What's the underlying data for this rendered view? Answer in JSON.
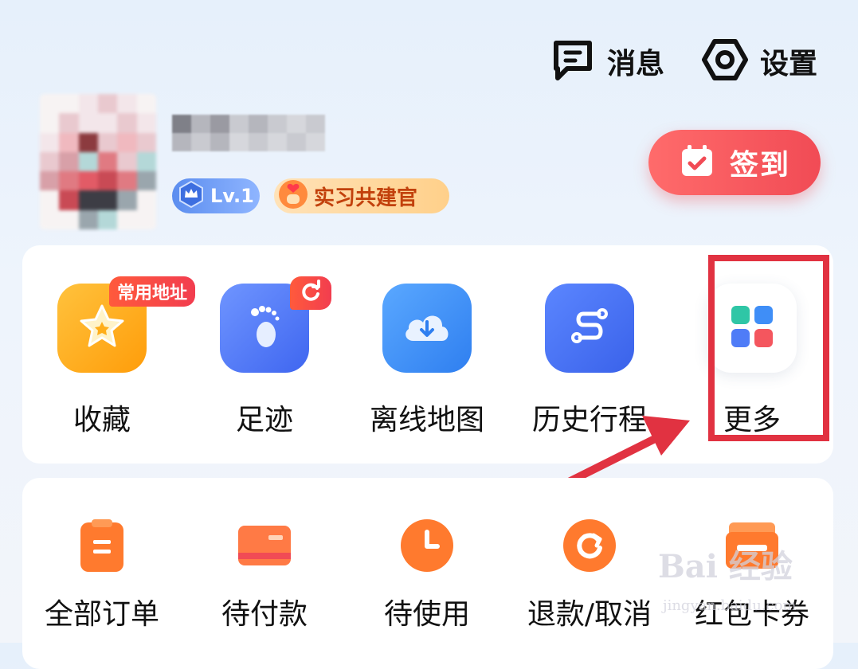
{
  "header": {
    "messages_label": "消息",
    "settings_label": "设置"
  },
  "profile": {
    "level_badge": "Lv.1",
    "title_badge": "实习共建官",
    "checkin_label": "签到"
  },
  "tools": [
    {
      "label": "收藏",
      "icon": "star-icon",
      "color": "#ffb31a",
      "tag": "常用地址"
    },
    {
      "label": "足迹",
      "icon": "footprint-icon",
      "color": "#4f7cf7"
    },
    {
      "label": "离线地图",
      "icon": "cloud-download-icon",
      "color": "#3d8ef7"
    },
    {
      "label": "历史行程",
      "icon": "route-icon",
      "color": "#3b73f0"
    },
    {
      "label": "更多",
      "icon": "grid-icon",
      "color": "#ffffff"
    }
  ],
  "orders": [
    {
      "label": "全部订单",
      "icon": "clipboard-icon"
    },
    {
      "label": "待付款",
      "icon": "card-icon"
    },
    {
      "label": "待使用",
      "icon": "clock-icon"
    },
    {
      "label": "退款/取消",
      "icon": "refresh-icon"
    },
    {
      "label": "红包卡券",
      "icon": "wallet-icon"
    }
  ],
  "watermark": {
    "brand": "Bai 经验",
    "url": "jingyan.baidu.com"
  },
  "colors": {
    "accent_red": "#f14b55",
    "annotation_red": "#e13241"
  }
}
